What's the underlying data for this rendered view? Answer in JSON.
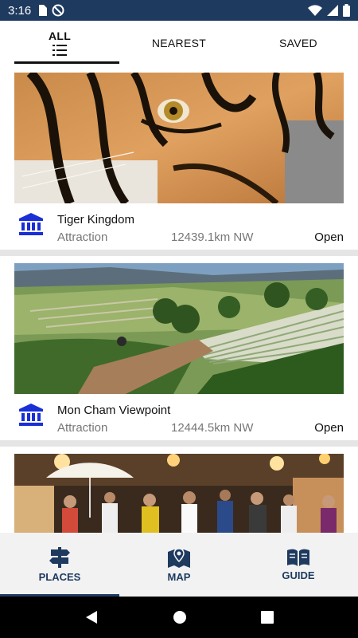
{
  "status": {
    "time": "3:16"
  },
  "tabs": [
    {
      "label": "ALL"
    },
    {
      "label": "NEAREST"
    },
    {
      "label": "SAVED"
    }
  ],
  "places": [
    {
      "name": "Tiger Kingdom",
      "type": "Attraction",
      "distance": "12439.1km NW",
      "status": "Open",
      "image": "tiger-photo"
    },
    {
      "name": "Mon Cham Viewpoint",
      "type": "Attraction",
      "distance": "12444.5km NW",
      "status": "Open",
      "image": "mountain-farm-photo"
    },
    {
      "name": "",
      "type": "",
      "distance": "",
      "status": "",
      "image": "night-market-photo"
    }
  ],
  "bottom_nav": [
    {
      "label": "PLACES",
      "icon": "signpost-icon"
    },
    {
      "label": "MAP",
      "icon": "map-icon"
    },
    {
      "label": "GUIDE",
      "icon": "book-icon"
    }
  ],
  "colors": {
    "primary": "#1e3a5f",
    "icon_blue": "#1a2fd6"
  }
}
